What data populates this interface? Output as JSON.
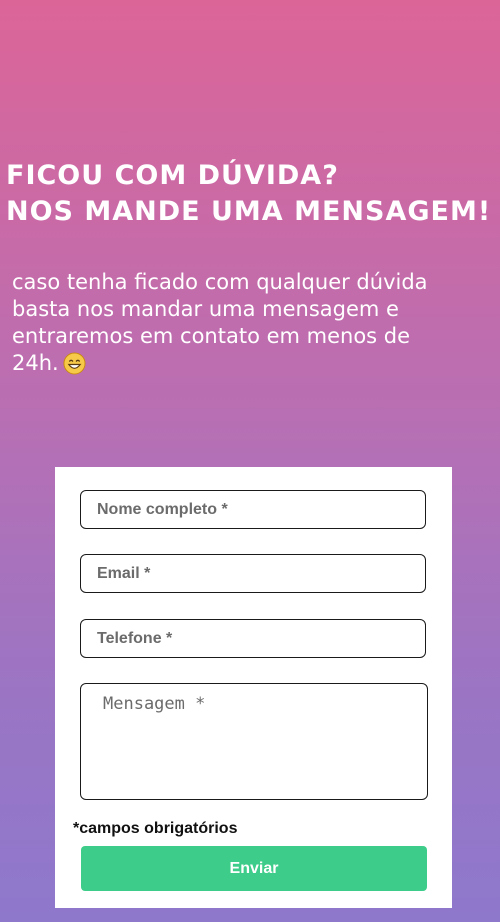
{
  "header": {
    "title_line1": "FICOU COM DÚVIDA?",
    "title_line2": "NOS MANDE UMA MENSAGEM!"
  },
  "intro": {
    "text": "caso tenha ficado com qualquer dúvida basta nos mandar uma mensagem e entraremos em contato em menos de 24h.",
    "emoji_icon": "grinning-face-icon"
  },
  "form": {
    "name_placeholder": "Nome completo *",
    "email_placeholder": "Email *",
    "phone_placeholder": "Telefone *",
    "message_placeholder": "Mensagem *",
    "required_note": "*campos obrigatórios",
    "submit_label": "Enviar"
  },
  "colors": {
    "gradient_top": "#dc6598",
    "gradient_bottom": "#8e78cc",
    "submit_button": "#3ecc8a",
    "card_background": "#ffffff"
  }
}
